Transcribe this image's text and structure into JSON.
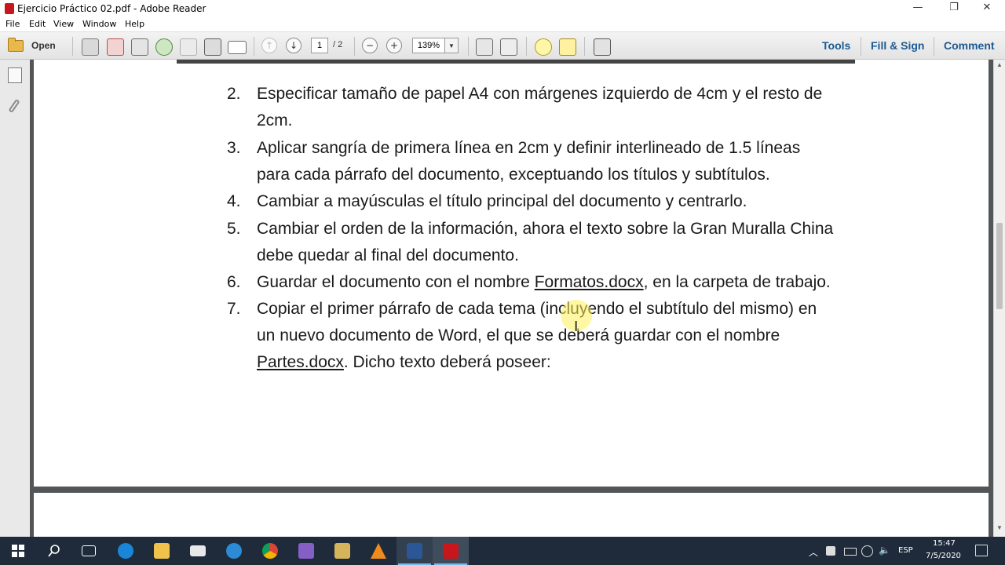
{
  "window": {
    "title": "Ejercicio Práctico 02.pdf - Adobe Reader",
    "controls": {
      "minimize": "—",
      "maximize": "❐",
      "close": "✕"
    }
  },
  "menu": [
    "File",
    "Edit",
    "View",
    "Window",
    "Help"
  ],
  "toolbar": {
    "open_label": "Open",
    "page_current": "1",
    "page_total": "/ 2",
    "zoom": "139%",
    "right_tabs": [
      "Tools",
      "Fill & Sign",
      "Comment"
    ]
  },
  "document": {
    "items": [
      {
        "num": "2.",
        "lines": [
          "Especificar tamaño de papel A4 con márgenes izquierdo de 4cm y el resto de",
          "2cm."
        ]
      },
      {
        "num": "3.",
        "lines": [
          "Aplicar sangría de primera línea en 2cm y definir interlineado de 1.5 líneas",
          "para cada párrafo del documento, exceptuando los títulos y subtítulos."
        ]
      },
      {
        "num": "4.",
        "lines": [
          "Cambiar a mayúsculas el título principal del documento y centrarlo."
        ]
      },
      {
        "num": "5.",
        "lines": [
          "Cambiar el orden de la información, ahora el texto sobre la Gran Muralla China",
          "debe quedar al final del documento."
        ]
      },
      {
        "num": "6.",
        "before": "Guardar el documento con el nombre ",
        "link": "Formatos.docx",
        "after": ", en la carpeta de trabajo."
      },
      {
        "num": "7.",
        "lines": [
          "Copiar el primer párrafo de cada tema (incluyendo el subtítulo del mismo) en",
          "un nuevo documento de Word, el que se deberá guardar con el nombre"
        ],
        "last_link": "Partes.docx",
        "last_after": ". Dicho texto deberá poseer:"
      }
    ]
  },
  "taskbar": {
    "language": "ESP",
    "time": "15:47",
    "date": "7/5/2020"
  }
}
